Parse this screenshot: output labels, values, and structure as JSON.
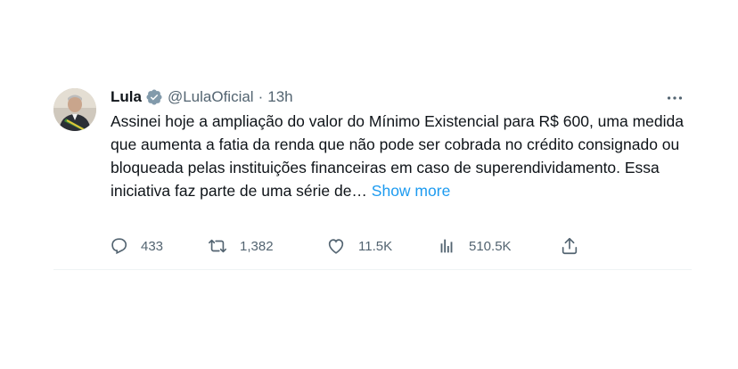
{
  "tweet": {
    "author_name": "Lula",
    "handle": "@LulaOficial",
    "separator": "·",
    "time": "13h",
    "text": "Assinei hoje a ampliação do valor do Mínimo Existencial para R$ 600, uma medida que aumenta a fatia da renda que não pode ser cobrada no crédito consignado ou bloqueada pelas instituições financeiras em caso de superendividamento. Essa iniciativa faz parte de uma série de…",
    "show_more": "Show more",
    "verified_badge_color": "#829aab",
    "link_color": "#1d9bf0",
    "actions": {
      "replies": "433",
      "retweets": "1,382",
      "likes": "11.5K",
      "views": "510.5K"
    },
    "icons": [
      "verified-badge-icon",
      "more-options-icon",
      "reply-icon",
      "retweet-icon",
      "like-icon",
      "views-icon",
      "share-icon"
    ]
  }
}
